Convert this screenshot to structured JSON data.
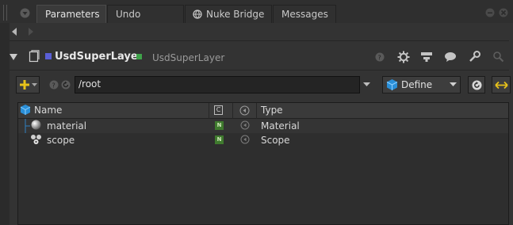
{
  "tabs": [
    {
      "label": "Parameters",
      "active": true
    },
    {
      "label": "Undo History",
      "active": false
    },
    {
      "label": "Nuke Bridge",
      "active": false
    },
    {
      "label": "Messages",
      "active": false
    }
  ],
  "node": {
    "title": "UsdSuperLaye",
    "class_name": "UsdSuperLayer",
    "title_color": "#5a5fd6",
    "status_color": "#3fa34a"
  },
  "path_row": {
    "path_value": "/root",
    "mode_value": "Define",
    "accent_color": "#e8c21a"
  },
  "table": {
    "headers": {
      "name": "Name",
      "c": "C",
      "type": "Type"
    },
    "rows": [
      {
        "name": "material",
        "badge": "N",
        "type": "Material",
        "icon": "sphere-icon"
      },
      {
        "name": "scope",
        "badge": "N",
        "type": "Scope",
        "icon": "scope-icon"
      }
    ]
  },
  "icons": [
    "menu-icon",
    "gear-icon",
    "help-icon",
    "node-graph-icon",
    "comment-icon",
    "wrench-icon",
    "search-icon",
    "minimize-icon",
    "close-icon",
    "back-icon",
    "forward-icon",
    "add-icon",
    "refresh-icon",
    "swap-icon",
    "usd-cube-icon"
  ]
}
